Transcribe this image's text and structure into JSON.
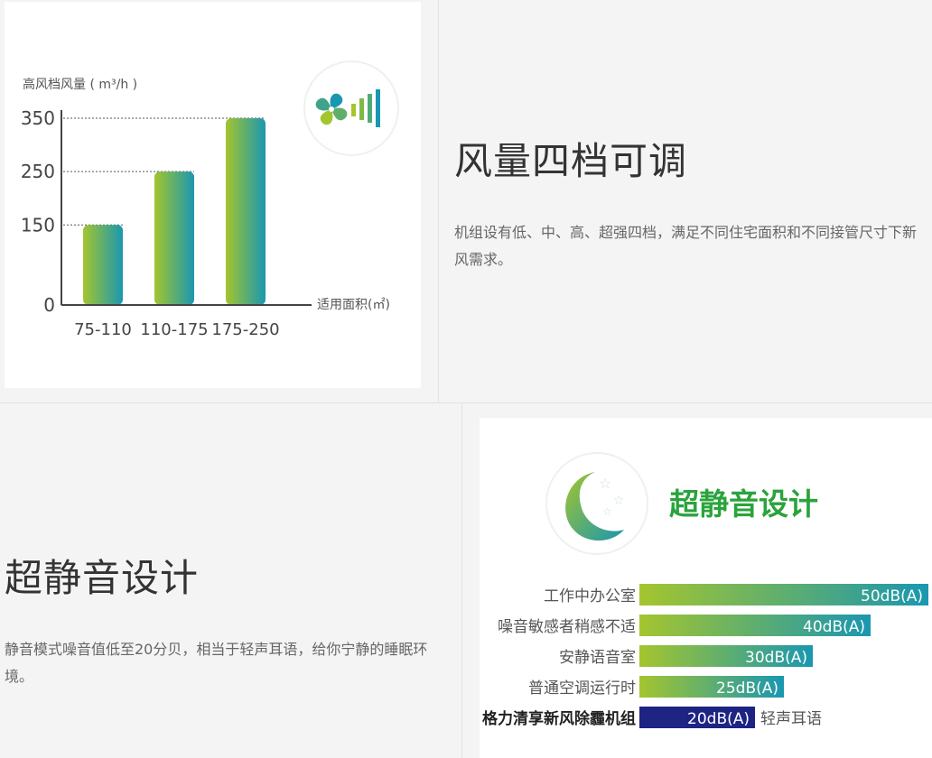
{
  "colors": {
    "gradient_start": "#a4c52e",
    "gradient_end": "#1a97b0",
    "highlight_bar": "#1d2484",
    "title_green": "#2aa33c",
    "background": "#f4f4f4"
  },
  "airflow": {
    "heading": "风量四档可调",
    "description": "机组设有低、中、高、超强四档，满足不同住宅面积和不同接管尺寸下新风需求。",
    "icon": "fan-signal-icon",
    "chart_data": {
      "type": "bar",
      "ylabel": "高风档风量 ( m³/h )",
      "xlabel": "适用面积(㎡)",
      "categories": [
        "75-110",
        "110-175",
        "175-250"
      ],
      "values": [
        150,
        250,
        350
      ],
      "y_ticks": [
        0,
        150,
        250,
        350
      ],
      "ylim": [
        0,
        370
      ],
      "grid": "dotted reference lines at bar tops"
    }
  },
  "silence": {
    "heading": "超静音设计",
    "description": "静音模式噪音值低至20分贝，相当于轻声耳语，给你宁静的睡眠环境。",
    "title": "超静音设计",
    "icon": "moon-stars-icon",
    "chart_data": {
      "type": "bar",
      "orientation": "horizontal",
      "categories": [
        "工作中办公室",
        "噪音敏感者稍感不适",
        "安静语音室",
        "普通空调运行时",
        "格力清享新风除霾机组"
      ],
      "values": [
        50,
        40,
        30,
        25,
        20
      ],
      "value_labels": [
        "50dB(A)",
        "40dB(A)",
        "30dB(A)",
        "25dB(A)",
        "20dB(A)"
      ],
      "highlight_index": 4,
      "annotation": "轻声耳语"
    }
  }
}
